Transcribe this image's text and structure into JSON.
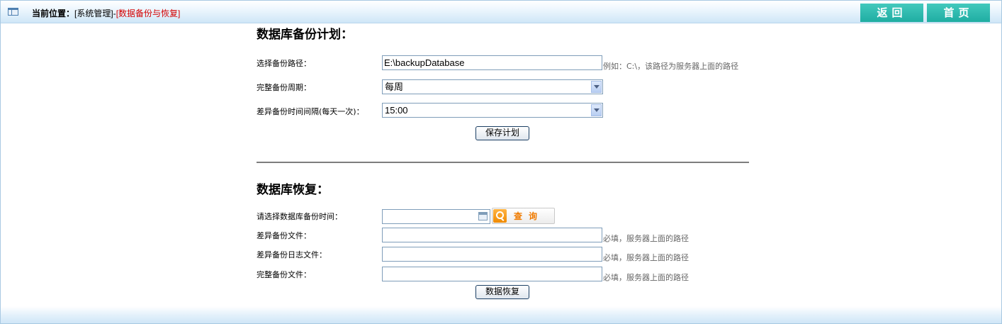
{
  "header": {
    "location_label": "当前位置：",
    "breadcrumb_parent": "[系统管理]-",
    "breadcrumb_current": "[数据备份与恢复]",
    "back_button": "返回",
    "home_button": "首页"
  },
  "backup_plan": {
    "title": "数据库备份计划：",
    "path_label": "选择备份路径：",
    "path_value": "E:\\backupDatabase",
    "path_hint": "例如：C:\\，该路径为服务器上面的路径",
    "full_cycle_label": "完整备份周期：",
    "full_cycle_value": "每周",
    "diff_interval_label": "差异备份时间间隔(每天一次)：",
    "diff_interval_value": "15:00",
    "save_button": "保存计划"
  },
  "restore": {
    "title": "数据库恢复：",
    "time_label": "请选择数据库备份时间：",
    "time_value": "",
    "query_button": "查询",
    "diff_file_label": "差异备份文件：",
    "diff_log_label": "差异备份日志文件：",
    "full_file_label": "完整备份文件：",
    "required_hint": "必填，服务器上面的路径",
    "restore_button": "数据恢复"
  },
  "colors": {
    "accent_teal": "#1fada2",
    "breadcrumb_current": "#d40000",
    "query_orange": "#f07b00"
  },
  "icons": [
    "window-icon",
    "calendar-icon",
    "search-icon",
    "chevron-down-icon"
  ]
}
